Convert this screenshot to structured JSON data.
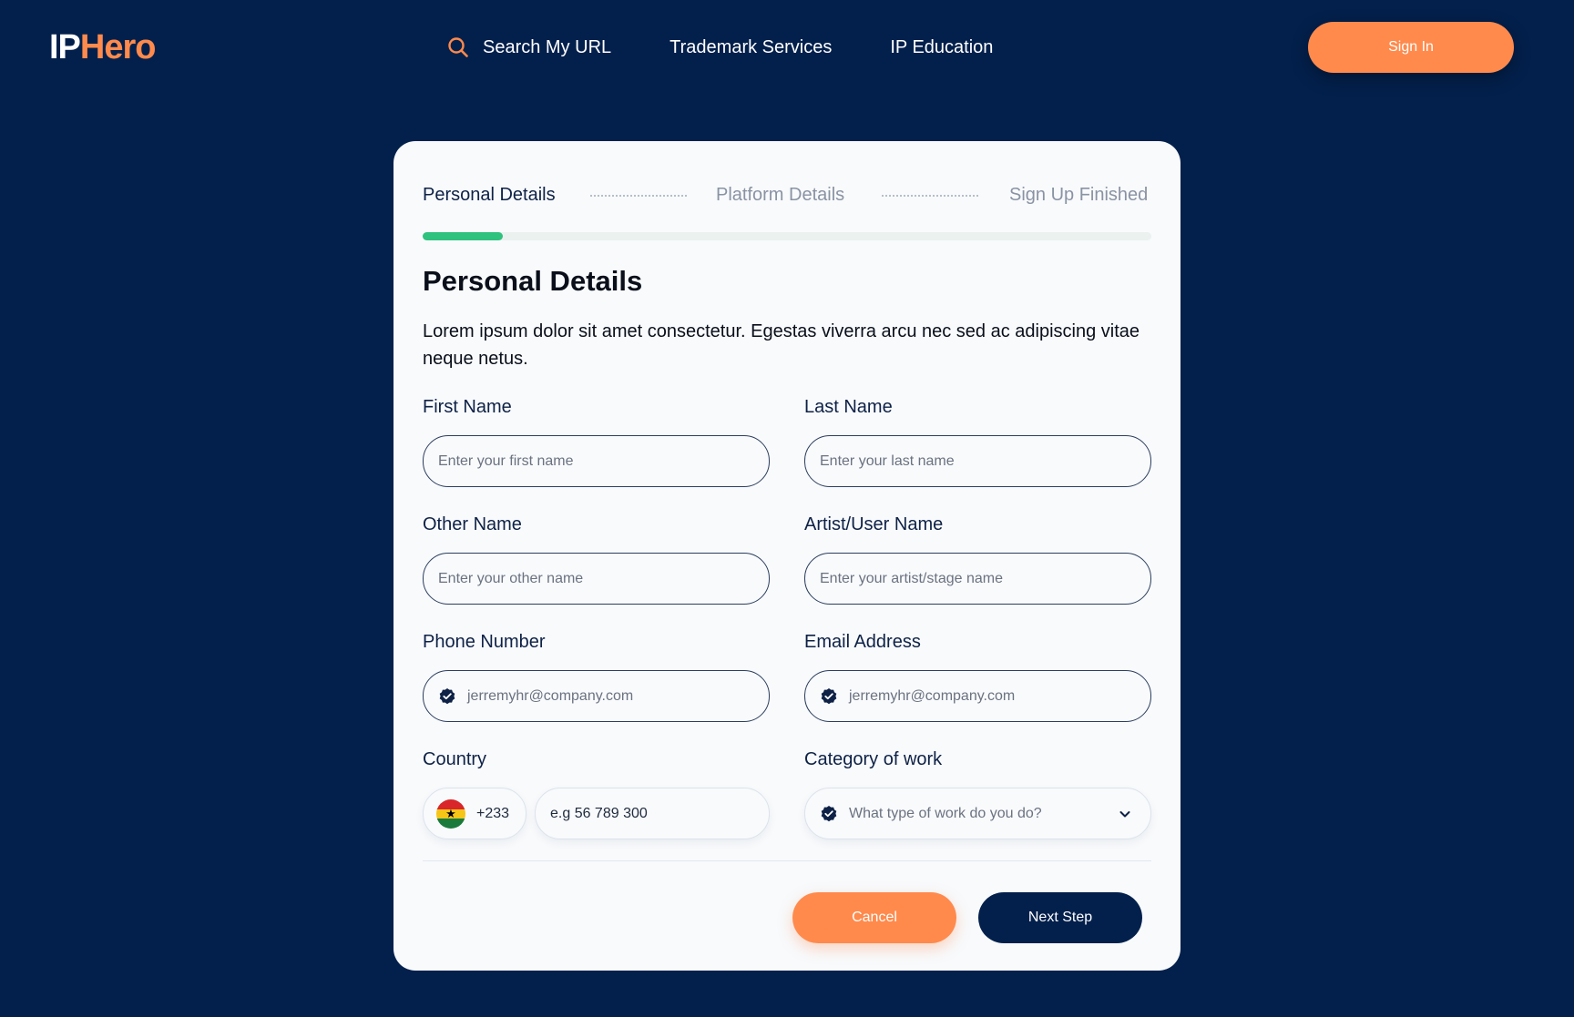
{
  "brand": {
    "logo_part1": "IP",
    "logo_part2": "Hero",
    "accent": "#ff8a4c",
    "navy": "#03204c",
    "success": "#2ec27e"
  },
  "nav": {
    "links": [
      {
        "label": "Search My URL",
        "icon": "search-icon"
      },
      {
        "label": "Trademark Services"
      },
      {
        "label": "IP Education"
      }
    ],
    "signin_label": "Sign In"
  },
  "stepper": {
    "steps": [
      {
        "label": "Personal Details",
        "state": "active"
      },
      {
        "label": "Platform Details",
        "state": "inactive"
      },
      {
        "label": "Sign Up Finished",
        "state": "inactive"
      }
    ],
    "progress": 0.11
  },
  "form": {
    "title": "Personal Details",
    "description": "Lorem ipsum dolor sit amet consectetur. Egestas viverra arcu nec sed ac adipiscing vitae neque netus.",
    "first_name": {
      "label": "First Name",
      "placeholder": "Enter your first name"
    },
    "last_name": {
      "label": "Last Name",
      "placeholder": "Enter your last name"
    },
    "other_name": {
      "label": "Other Name",
      "placeholder": "Enter your other name"
    },
    "artist_name": {
      "label": "Artist/User Name",
      "placeholder": "Enter your artist/stage name"
    },
    "phone": {
      "label": "Phone Number",
      "value": "jerremyhr@company.com",
      "icon": "check-badge-icon"
    },
    "email": {
      "label": "Email Address",
      "value": "jerremyhr@company.com",
      "icon": "check-badge-icon"
    },
    "country": {
      "label": "Country",
      "dial_code": "+233",
      "flag": "ghana-flag-icon",
      "number_placeholder": "e.g 56 789 300"
    },
    "category": {
      "label": "Category of work",
      "placeholder": "What type of work do you do?",
      "icon": "check-badge-icon",
      "dropdown_icon": "chevron-down-icon"
    }
  },
  "actions": {
    "cancel_label": "Cancel",
    "next_label": "Next Step"
  }
}
